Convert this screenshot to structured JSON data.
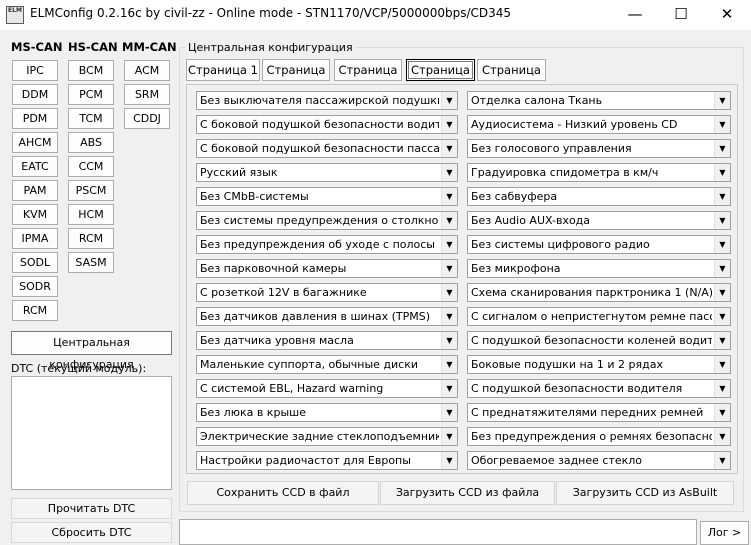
{
  "window": {
    "icon_text": "ELM",
    "title": "ELMConfig 0.2.16c by civil-zz - Online mode - STN1170/VCP/5000000bps/CD345",
    "minimize_glyph": "—",
    "maximize_glyph": "☐",
    "close_glyph": "✕"
  },
  "modules": {
    "ms_can": {
      "label": "MS-CAN",
      "items": [
        "IPC",
        "DDM",
        "PDM",
        "AHCM",
        "EATC",
        "PAM",
        "KVM",
        "IPMA",
        "SODL",
        "SODR",
        "RCM"
      ]
    },
    "hs_can": {
      "label": "HS-CAN",
      "items": [
        "BCM",
        "PCM",
        "TCM",
        "ABS",
        "CCM",
        "PSCM",
        "HCM",
        "RCM",
        "SASM"
      ]
    },
    "mm_can": {
      "label": "MM-CAN",
      "items": [
        "ACM",
        "SRM",
        "CDDJ"
      ]
    }
  },
  "central_config_button": "Центральная конфигурация",
  "dtc": {
    "label": "DTC (текущий модуль):",
    "value": "",
    "read_button": "Прочитать DTC",
    "reset_button": "Сбросить DTC"
  },
  "config": {
    "group_label": "Центральная конфигурация",
    "tabs": [
      "Страница 1",
      "Страница 2",
      "Страница 3",
      "Страница 4",
      "Страница 5"
    ],
    "active_tab": "Страница 4",
    "left_options": [
      "Без выключателя пассажирской подушки",
      "С боковой подушкой безопасности водителя",
      "С боковой подушкой безопасности пассажира",
      "Русский язык",
      "Без CMbB-системы",
      "Без системы предупреждения о столкновении",
      "Без предупреждения об уходе с полосы",
      "Без парковочной камеры",
      "С розеткой 12V в багажнике",
      "Без датчиков давления в шинах (TPMS)",
      "Без датчика уровня масла",
      "Маленькие суппорта, обычные диски",
      "С системой EBL, Hazard warning",
      "Без люка в крыше",
      "Электрические задние стеклоподъемники",
      "Настройки радиочастот для Европы"
    ],
    "right_options": [
      "Отделка салона Ткань",
      "Аудиосистема - Низкий уровень CD",
      "Без голосового управления",
      "Градуировка спидометра в км/ч",
      "Без сабвуфера",
      "Без Audio AUX-входа",
      "Без системы цифрового радио",
      "Без микрофона",
      "Схема сканирования парктроника 1 (N/A)",
      "С сигналом о непристегнутом ремне пассажира",
      "С подушкой безопасности коленей водителя",
      "Боковые подушки на 1 и 2 рядах",
      "С подушкой безопасности водителя",
      "С преднатяжителями передних ремней",
      "Без предупреждения о ремнях безопасности",
      "Обогреваемое заднее стекло"
    ],
    "dropdown_arrow_glyph": "▼"
  },
  "actions": {
    "save": "Сохранить CCD в файл",
    "load": "Загрузить CCD из файла",
    "load_asbuilt": "Загрузить CCD из AsBuilt"
  },
  "log": {
    "value": "",
    "button": "Лог >"
  }
}
